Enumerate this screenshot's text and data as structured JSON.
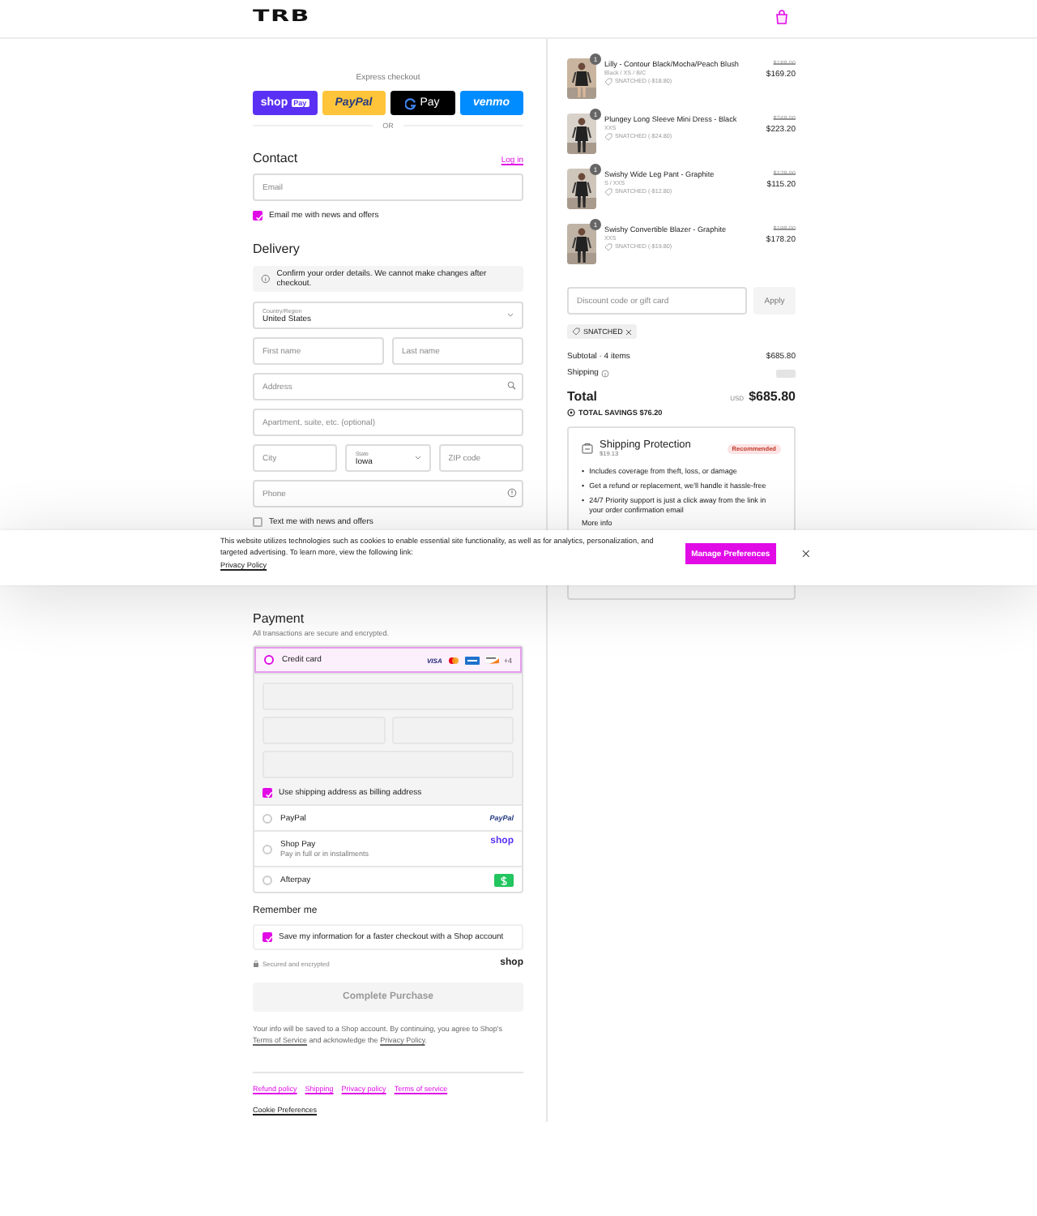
{
  "header": {
    "logo": "TRB"
  },
  "express_checkout": {
    "title": "Express checkout",
    "buttons": [
      {
        "kind": "shoppay",
        "label": "shop",
        "badge": "Pay"
      },
      {
        "kind": "paypal",
        "label": "PayPal"
      },
      {
        "kind": "gpay",
        "label": "Pay"
      },
      {
        "kind": "venmo",
        "label": "venmo"
      }
    ],
    "divider": "OR"
  },
  "contact": {
    "title": "Contact",
    "login": "Log in",
    "email": {
      "placeholder": "Email"
    },
    "newsletter": {
      "label": "Email me with news and offers",
      "checked": true
    }
  },
  "delivery": {
    "title": "Delivery",
    "notice": "Confirm your order details. We cannot make changes after checkout.",
    "country": {
      "label": "Country/Region",
      "value": "United States"
    },
    "first_name": {
      "placeholder": "First name"
    },
    "last_name": {
      "placeholder": "Last name"
    },
    "address": {
      "placeholder": "Address"
    },
    "apartment": {
      "placeholder": "Apartment, suite, etc. (optional)"
    },
    "city": {
      "placeholder": "City"
    },
    "state": {
      "label": "State",
      "value": "Iowa"
    },
    "zip": {
      "placeholder": "ZIP code"
    },
    "phone": {
      "placeholder": "Phone"
    },
    "sms": {
      "label": "Text me with news and offers",
      "checked": false
    }
  },
  "payment": {
    "title": "Payment",
    "subtitle": "All transactions are secure and encrypted.",
    "methods": [
      {
        "kind": "card",
        "label": "Credit card",
        "selected": true,
        "logo": "VISA",
        "more": "+4"
      },
      {
        "kind": "paypal",
        "label": "PayPal",
        "selected": false,
        "logo": "PayPal"
      },
      {
        "kind": "shoppay",
        "label": "Shop Pay",
        "sublabel": "Pay in full or in installments",
        "selected": false,
        "logo": "shop"
      },
      {
        "kind": "afterpay",
        "label": "Afterpay",
        "selected": false
      }
    ],
    "billing_same": {
      "label": "Use shipping address as billing address",
      "checked": true
    }
  },
  "remember": {
    "title": "Remember me",
    "save": {
      "label": "Save my information for a faster checkout with a Shop account",
      "checked": true
    },
    "secure": "Secured and encrypted",
    "logo": "shop"
  },
  "complete_button": "Complete Purchase",
  "legal": {
    "before": "Your info will be saved to a Shop account. By continuing, you agree to Shop's ",
    "terms": "Terms of Service",
    "middle": " and acknowledge the ",
    "privacy": "Privacy Policy",
    "after": "."
  },
  "footer_links": [
    "Refund policy",
    "Shipping",
    "Privacy policy",
    "Terms of service"
  ],
  "cookie_preferences": "Cookie Preferences",
  "order": {
    "items": [
      {
        "quantity": "1",
        "name": "Lilly - Contour Black/Mocha/Peach Blush",
        "variant": "Black / XS / B/C",
        "discount": "SNATCHED (-$18.80)",
        "original_price": "$188.00",
        "price": "$169.20"
      },
      {
        "quantity": "1",
        "name": "Plungey Long Sleeve Mini Dress - Black",
        "variant": "XXS",
        "discount": "SNATCHED (-$24.80)",
        "original_price": "$248.00",
        "price": "$223.20"
      },
      {
        "quantity": "1",
        "name": "Swishy Wide Leg Pant - Graphite",
        "variant": "S / XXS",
        "discount": "SNATCHED (-$12.80)",
        "original_price": "$128.00",
        "price": "$115.20"
      },
      {
        "quantity": "1",
        "name": "Swishy Convertible Blazer - Graphite",
        "variant": "XXS",
        "discount": "SNATCHED (-$19.80)",
        "original_price": "$198.00",
        "price": "$178.20"
      }
    ],
    "discount": {
      "placeholder": "Discount code or gift card",
      "button": "Apply"
    },
    "applied_code": "SNATCHED",
    "subtotal_label": "Subtotal · 4 items",
    "subtotal": "$685.80",
    "shipping_label": "Shipping",
    "total_label": "Total",
    "currency": "USD",
    "total": "$685.80",
    "savings": "TOTAL SAVINGS $76.20",
    "protection": {
      "title": "Shipping Protection",
      "price": "$19.13",
      "badge": "Recommended",
      "bullet_mark": "•",
      "bullets": [
        "Includes coverage from theft, loss, or damage",
        "Get a refund or replacement, we'll handle it hassle-free",
        "24/7 Priority support is just a click away from the link in your order confirmation email"
      ],
      "more": "More info"
    }
  },
  "cookie_banner": {
    "text": "This website utilizes technologies such as cookies to enable essential site functionality, as well as for analytics, personalization, and targeted advertising. To learn more, view the following link:",
    "link": "Privacy Policy",
    "button": "Manage Preferences"
  }
}
